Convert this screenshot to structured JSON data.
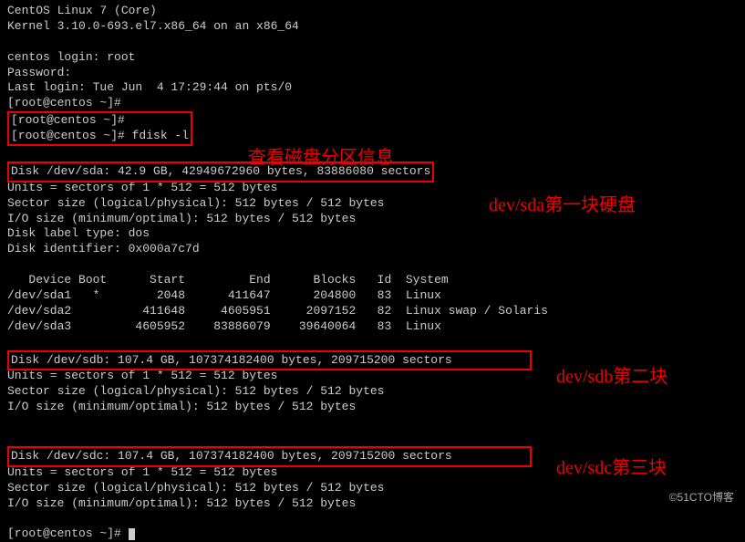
{
  "header": {
    "os_line": "CentOS Linux 7 (Core)",
    "kernel_line": "Kernel 3.10.0-693.el7.x86_64 on an x86_64"
  },
  "login": {
    "login_prompt": "centos login: root",
    "password_prompt": "Password:",
    "last_login": "Last login: Tue Jun  4 17:29:44 on pts/0"
  },
  "prompts": {
    "p1": "[root@centos ~]#",
    "p2": "[root@centos ~]#",
    "p3": "[root@centos ~]# fdisk -l",
    "p4": "[root@centos ~]# "
  },
  "annotations": {
    "ann1": "查看磁盘分区信息",
    "ann2": "dev/sda第一块硬盘",
    "ann3": "dev/sdb第二块",
    "ann4": "dev/sdc第三块"
  },
  "disk_sda": {
    "summary": "Disk /dev/sda: 42.9 GB, 42949672960 bytes, 83886080 sectors",
    "units": "Units = sectors of 1 * 512 = 512 bytes",
    "sector_size": "Sector size (logical/physical): 512 bytes / 512 bytes",
    "io_size": "I/O size (minimum/optimal): 512 bytes / 512 bytes",
    "label": "Disk label type: dos",
    "identifier": "Disk identifier: 0x000a7c7d"
  },
  "partition_table": {
    "header": "   Device Boot      Start         End      Blocks   Id  System",
    "rows": [
      "/dev/sda1   *        2048      411647      204800   83  Linux",
      "/dev/sda2          411648     4605951     2097152   82  Linux swap / Solaris",
      "/dev/sda3         4605952    83886079    39640064   83  Linux"
    ]
  },
  "disk_sdb": {
    "summary": "Disk /dev/sdb: 107.4 GB, 107374182400 bytes, 209715200 sectors",
    "units": "Units = sectors of 1 * 512 = 512 bytes",
    "sector_size": "Sector size (logical/physical): 512 bytes / 512 bytes",
    "io_size": "I/O size (minimum/optimal): 512 bytes / 512 bytes"
  },
  "disk_sdc": {
    "summary": "Disk /dev/sdc: 107.4 GB, 107374182400 bytes, 209715200 sectors",
    "units": "Units = sectors of 1 * 512 = 512 bytes",
    "sector_size": "Sector size (logical/physical): 512 bytes / 512 bytes",
    "io_size": "I/O size (minimum/optimal): 512 bytes / 512 bytes"
  },
  "watermark": "©51CTO博客"
}
